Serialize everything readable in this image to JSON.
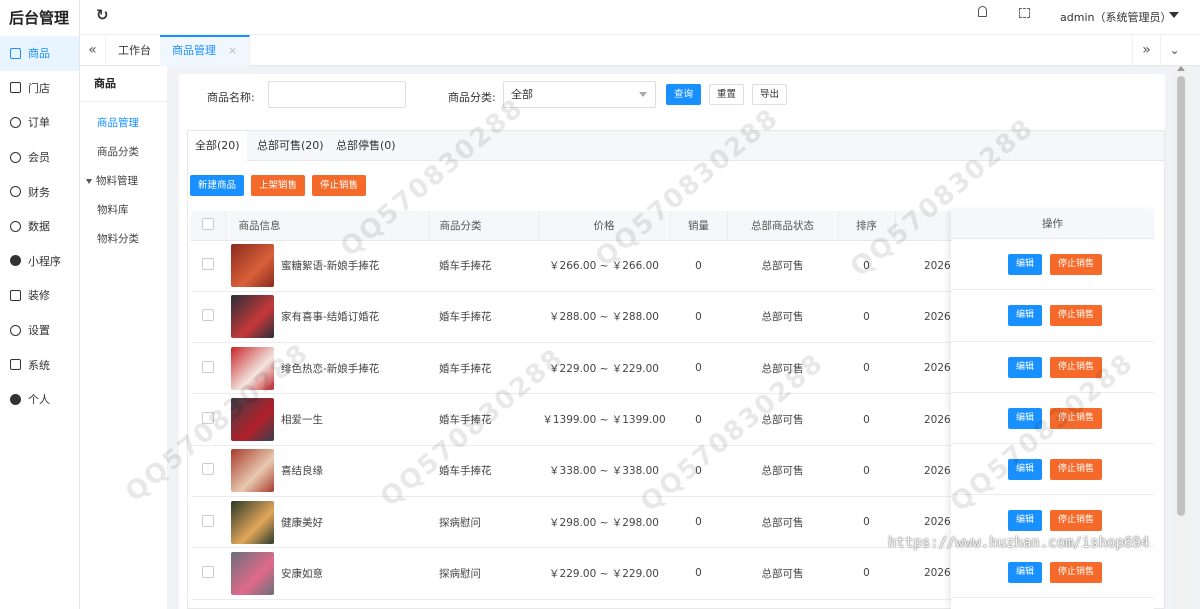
{
  "app": {
    "logo": "后台管理"
  },
  "sidebar": {
    "items": [
      {
        "label": "商品",
        "icon": "cart-icon",
        "active": true
      },
      {
        "label": "门店",
        "icon": "store-icon"
      },
      {
        "label": "订单",
        "icon": "bell-icon"
      },
      {
        "label": "会员",
        "icon": "user-icon"
      },
      {
        "label": "财务",
        "icon": "finance-icon"
      },
      {
        "label": "数据",
        "icon": "globe-icon"
      },
      {
        "label": "小程序",
        "icon": "miniapp-icon"
      },
      {
        "label": "装修",
        "icon": "phone-icon"
      },
      {
        "label": "设置",
        "icon": "gear-icon"
      },
      {
        "label": "系统",
        "icon": "system-icon"
      },
      {
        "label": "个人",
        "icon": "person-icon"
      }
    ]
  },
  "topbar": {
    "user": "admin（系统管理员）"
  },
  "tabs": [
    {
      "label": "工作台"
    },
    {
      "label": "商品管理",
      "active": true,
      "close": "×"
    }
  ],
  "subnav": {
    "title": "商品",
    "items": [
      {
        "label": "商品管理",
        "active": true
      },
      {
        "label": "商品分类"
      },
      {
        "label": "物料管理",
        "group": true
      },
      {
        "label": "物料库"
      },
      {
        "label": "物料分类"
      }
    ]
  },
  "filter": {
    "name_label": "商品名称:",
    "name_value": "",
    "category_label": "商品分类:",
    "category_value": "全部",
    "query": "查询",
    "reset": "重置",
    "export": "导出"
  },
  "status_tabs": [
    {
      "label": "全部(20)",
      "active": true
    },
    {
      "label": "总部可售(20)"
    },
    {
      "label": "总部停售(0)"
    }
  ],
  "actions": {
    "new": "新建商品",
    "on_sale": "上架销售",
    "stop_sale": "停止销售"
  },
  "table": {
    "headers": [
      "商品信息",
      "商品分类",
      "价格",
      "销量",
      "总部商品状态",
      "排序",
      "操作"
    ],
    "edit_label": "编辑",
    "stop_label": "停止销售",
    "rows": [
      {
        "name": "蜜糖絮语-新娘手捧花",
        "category": "婚车手捧花",
        "price": "￥266.00 ~ ￥266.00",
        "sales": "0",
        "status": "总部可售",
        "sort": "0",
        "date": "2026",
        "thumb": [
          "#8a2a1e",
          "#d9603a"
        ]
      },
      {
        "name": "家有喜事-结婚订婚花",
        "category": "婚车手捧花",
        "price": "￥288.00 ~ ￥288.00",
        "sales": "0",
        "status": "总部可售",
        "sort": "0",
        "date": "2026",
        "thumb": [
          "#2a2f3a",
          "#c73838"
        ]
      },
      {
        "name": "绯色热恋-新娘手捧花",
        "category": "婚车手捧花",
        "price": "￥229.00 ~ ￥229.00",
        "sales": "0",
        "status": "总部可售",
        "sort": "0",
        "date": "2026",
        "thumb": [
          "#c9252a",
          "#f2e6e0"
        ]
      },
      {
        "name": "相爱一生",
        "category": "婚车手捧花",
        "price": "￥1399.00 ~ ￥1399.00",
        "sales": "0",
        "status": "总部可售",
        "sort": "0",
        "date": "2026",
        "thumb": [
          "#3a3f4a",
          "#b3202a"
        ]
      },
      {
        "name": "喜结良缘",
        "category": "婚车手捧花",
        "price": "￥338.00 ~ ￥338.00",
        "sales": "0",
        "status": "总部可售",
        "sort": "0",
        "date": "2026",
        "thumb": [
          "#a83a2a",
          "#e8c9b0"
        ]
      },
      {
        "name": "健康美好",
        "category": "探病慰问",
        "price": "￥298.00 ~ ￥298.00",
        "sales": "0",
        "status": "总部可售",
        "sort": "0",
        "date": "2026",
        "thumb": [
          "#2a3a2a",
          "#e2a65a"
        ]
      },
      {
        "name": "安康如意",
        "category": "探病慰问",
        "price": "￥229.00 ~ ￥229.00",
        "sales": "0",
        "status": "总部可售",
        "sort": "0",
        "date": "2026",
        "thumb": [
          "#6a6f7a",
          "#e06a8a"
        ]
      }
    ]
  },
  "watermarks": {
    "qq": "QQ570830288",
    "url": "https://www.huzhan.com/ishop694"
  }
}
